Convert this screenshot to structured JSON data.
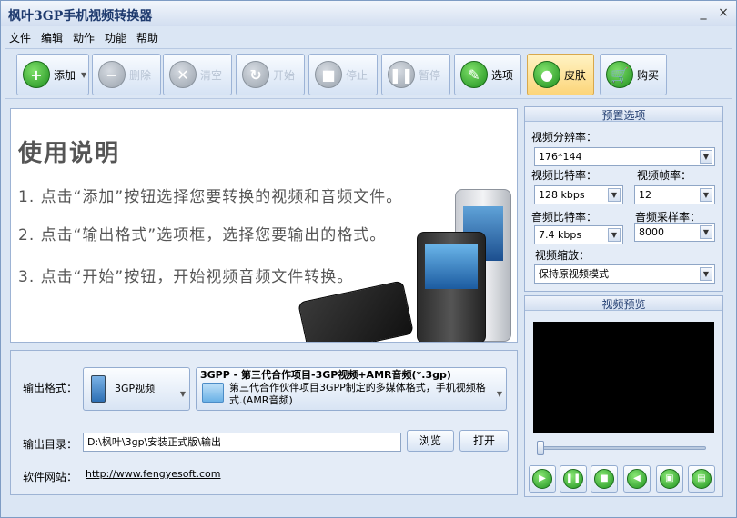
{
  "window": {
    "title": "枫叶3GP手机视频转换器",
    "min_label": "_",
    "close_label": "×"
  },
  "menu": [
    "文件",
    "编辑",
    "动作",
    "功能",
    "帮助"
  ],
  "toolbar": {
    "add": "添加",
    "delete": "删除",
    "clear": "清空",
    "start": "开始",
    "stop": "停止",
    "pause": "暂停",
    "options": "选项",
    "skin": "皮肤",
    "buy": "购买"
  },
  "intro": {
    "title": "使用说明",
    "steps": [
      "1. 点击“添加”按钮选择您要转换的视频和音频文件。",
      "2. 点击“输出格式”选项框，选择您要输出的格式。",
      "3. 点击“开始”按钮，开始视频音频文件转换。"
    ]
  },
  "preset": {
    "header": "预置选项",
    "resolution_label": "视频分辨率：",
    "resolution_value": "176*144",
    "vbitrate_label": "视频比特率：",
    "vbitrate_value": "128 kbps",
    "framerate_label": "视频帧率：",
    "framerate_value": "12",
    "abitrate_label": "音频比特率：",
    "abitrate_value": "7.4 kbps",
    "samplerate_label": "音频采样率：",
    "samplerate_value": "8000",
    "zoom_label": "视频缩放：",
    "zoom_value": "保持原视频模式"
  },
  "preview": {
    "header": "视频预览",
    "seek_position": 0.0
  },
  "output": {
    "format_label": "输出格式：",
    "format_value": "3GP视频",
    "format_desc_title": "3GPP - 第三代合作项目-3GP视频+AMR音频(*.3gp)",
    "format_desc_body": "第三代合作伙伴项目3GPP制定的多媒体格式，手机视频格式.(AMR音频)",
    "dir_label": "输出目录：",
    "dir_value": "D:\\枫叶\\3gp\\安装正式版\\输出",
    "browse": "浏览",
    "open": "打开",
    "site_label": "软件网站：",
    "site_url": "http://www.fengyesoft.com"
  }
}
